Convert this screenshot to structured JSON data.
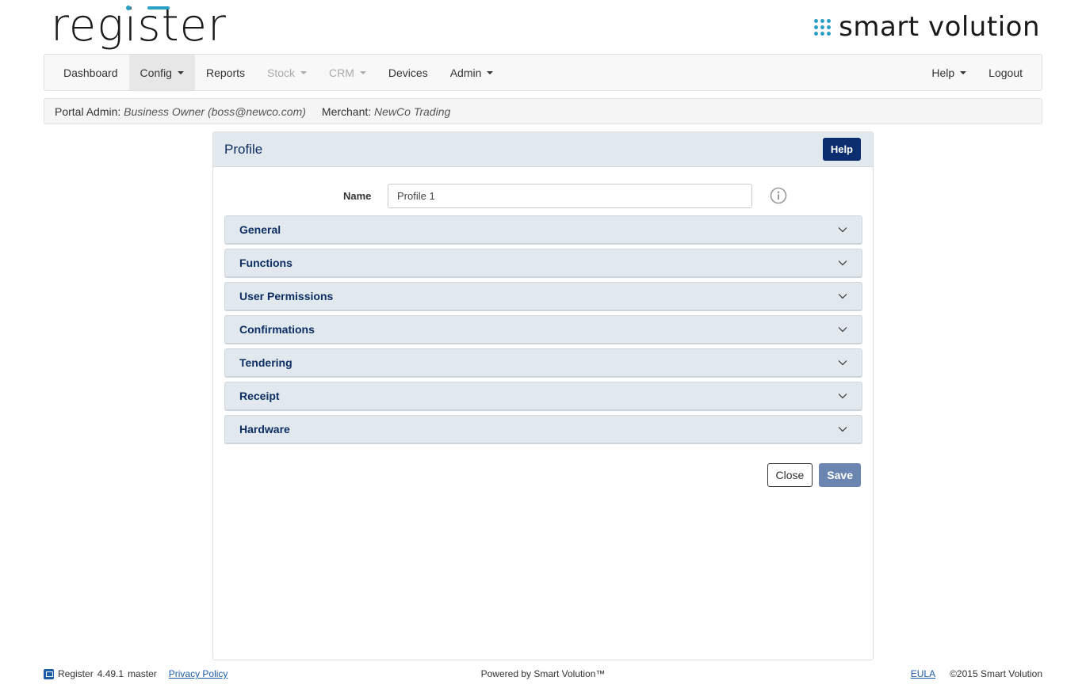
{
  "brand": {
    "left": "register",
    "right": "smart volution",
    "accent": "#2aa0c8"
  },
  "nav": {
    "left": [
      {
        "label": "Dashboard",
        "dropdown": false,
        "active": false,
        "disabled": false
      },
      {
        "label": "Config",
        "dropdown": true,
        "active": true,
        "disabled": false
      },
      {
        "label": "Reports",
        "dropdown": false,
        "active": false,
        "disabled": false
      },
      {
        "label": "Stock",
        "dropdown": true,
        "active": false,
        "disabled": true
      },
      {
        "label": "CRM",
        "dropdown": true,
        "active": false,
        "disabled": true
      },
      {
        "label": "Devices",
        "dropdown": false,
        "active": false,
        "disabled": false
      },
      {
        "label": "Admin",
        "dropdown": true,
        "active": false,
        "disabled": false
      }
    ],
    "right": [
      {
        "label": "Help",
        "dropdown": true
      },
      {
        "label": "Logout",
        "dropdown": false
      }
    ]
  },
  "context": {
    "admin_label": "Portal Admin:",
    "admin_value": "Business Owner (boss@newco.com)",
    "merchant_label": "Merchant:",
    "merchant_value": "NewCo Trading"
  },
  "panel": {
    "title": "Profile",
    "help_label": "Help",
    "name_label": "Name",
    "name_value": "Profile 1",
    "sections": [
      "General",
      "Functions",
      "User Permissions",
      "Confirmations",
      "Tendering",
      "Receipt",
      "Hardware"
    ],
    "close_label": "Close",
    "save_label": "Save"
  },
  "footer": {
    "app_name": "Register",
    "version": "4.49.1",
    "branch": "master",
    "privacy": "Privacy Policy",
    "powered": "Powered by Smart Volution™",
    "eula": "EULA",
    "copyright": "©2015 Smart Volution"
  },
  "colors": {
    "navy": "#0d2e63",
    "section_bg": "#e1e8ee",
    "save_bg": "#6a85b0",
    "help_bg": "#0d2e6e"
  }
}
